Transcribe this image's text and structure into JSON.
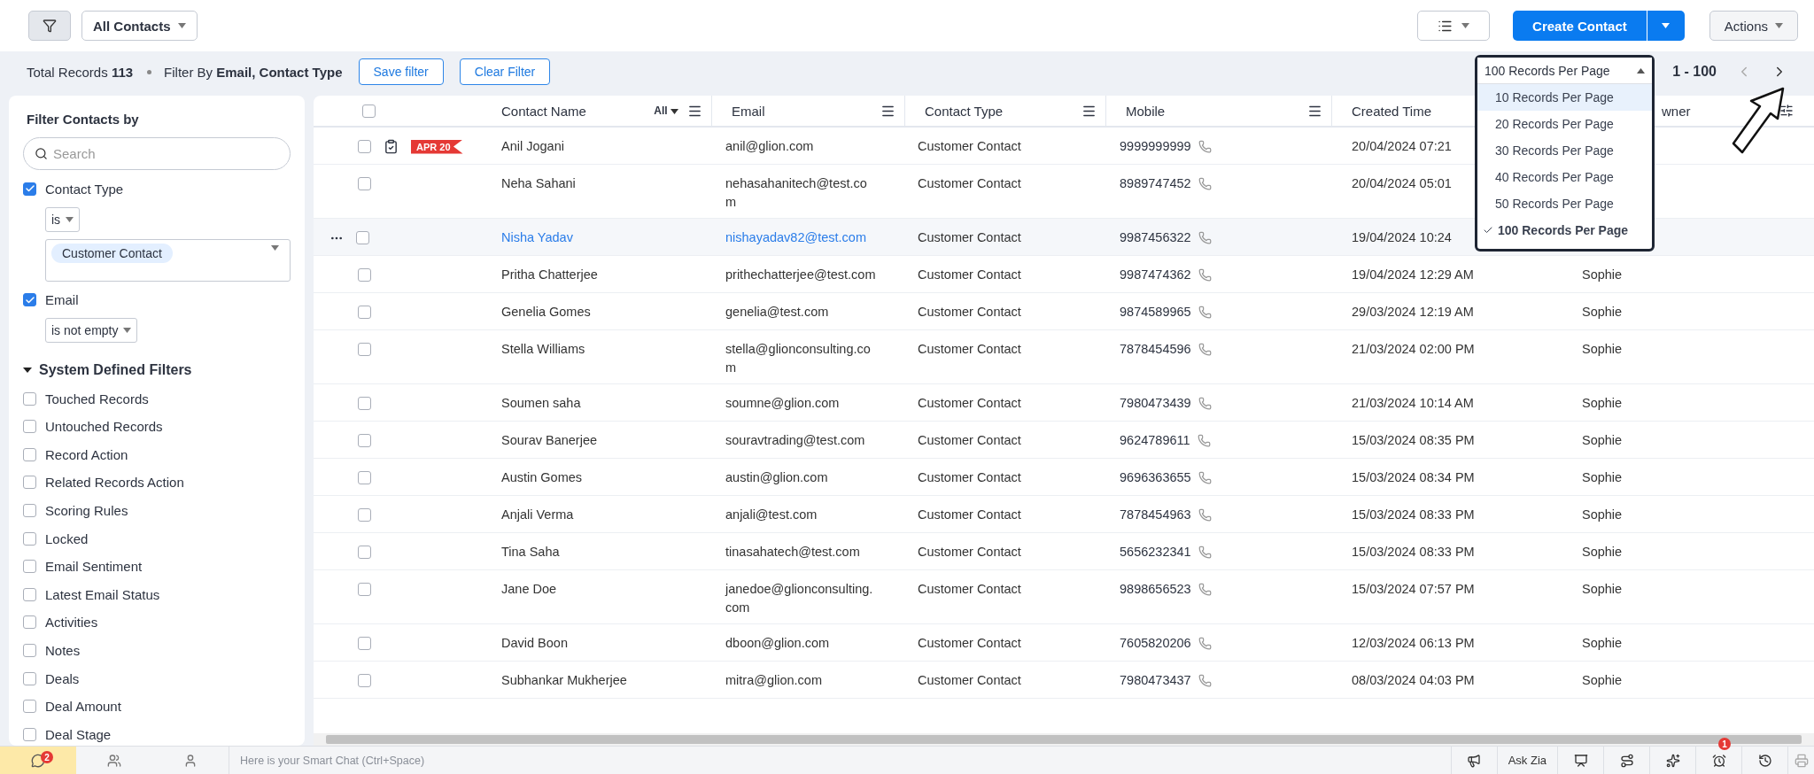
{
  "view_selector": {
    "label": "All Contacts"
  },
  "create_button": {
    "label": "Create Contact"
  },
  "actions_button": {
    "label": "Actions"
  },
  "filter_bar": {
    "summary": "Total Records **113**",
    "filter_by": "Filter By **Email, Contact Type**",
    "buttons": [
      "Save filter",
      "Clear Filter"
    ]
  },
  "pagination": {
    "per_page": {
      "value": "100 Records Per Page",
      "expanded": true,
      "options": [
        {
          "label": "10 Records Per Page",
          "selected": false,
          "highlighted": true
        },
        {
          "label": "20 Records Per Page",
          "selected": false,
          "highlighted": false
        },
        {
          "label": "30 Records Per Page",
          "selected": false,
          "highlighted": false
        },
        {
          "label": "40 Records Per Page",
          "selected": false,
          "highlighted": false
        },
        {
          "label": "50 Records Per Page",
          "selected": false,
          "highlighted": false
        },
        {
          "label": "100 Records Per Page",
          "selected": true,
          "highlighted": false
        }
      ]
    },
    "range": "1 - 100"
  },
  "sidebar": {
    "title": "Filter Contacts by",
    "search_placeholder": "Search",
    "field_filters": [
      {
        "label": "Contact Type",
        "checked": true,
        "operator": "is",
        "values": [
          "Customer Contact"
        ]
      },
      {
        "label": "Email",
        "checked": true,
        "operator": "is not empty"
      }
    ],
    "section": {
      "title": "System Defined Filters",
      "expanded": true,
      "items": [
        {
          "label": "Touched Records",
          "checked": false
        },
        {
          "label": "Untouched Records",
          "checked": false
        },
        {
          "label": "Record Action",
          "checked": false
        },
        {
          "label": "Related Records Action",
          "checked": false
        },
        {
          "label": "Scoring Rules",
          "checked": false
        },
        {
          "label": "Locked",
          "checked": false
        },
        {
          "label": "Email Sentiment",
          "checked": false
        },
        {
          "label": "Latest Email Status",
          "checked": false
        },
        {
          "label": "Activities",
          "checked": false
        },
        {
          "label": "Notes",
          "checked": false
        },
        {
          "label": "Deals",
          "checked": false
        },
        {
          "label": "Deal Amount",
          "checked": false
        },
        {
          "label": "Deal Stage",
          "checked": false
        }
      ]
    }
  },
  "table": {
    "select_all_checked": false,
    "columns": [
      {
        "label": "Contact Name",
        "filter": "All",
        "menu": true
      },
      {
        "label": "Email",
        "menu": true
      },
      {
        "label": "Contact Type",
        "menu": true
      },
      {
        "label": "Mobile",
        "menu": true
      },
      {
        "label": "Created Time",
        "menu": false
      },
      {
        "label": "wner"
      }
    ],
    "rows": [
      {
        "checked": false,
        "highlighted": false,
        "tag": "APR 20",
        "name": "Anil Jogani",
        "email": "anil@glion.com",
        "type": "Customer Contact",
        "mobile": "9999999999",
        "created": "20/04/2024 07:21"
      },
      {
        "checked": false,
        "highlighted": false,
        "name": "Neha Sahani",
        "email": "nehasahanitech@test.com",
        "type": "Customer Contact",
        "mobile": "8989747452",
        "created": "20/04/2024 05:01"
      },
      {
        "checked": false,
        "highlighted": true,
        "name": "Nisha Yadav",
        "email": "nishayadav82@test.com",
        "type": "Customer Contact",
        "mobile": "9987456322",
        "created": "19/04/2024 10:24"
      },
      {
        "checked": false,
        "highlighted": false,
        "name": "Pritha Chatterjee",
        "email": "prithechatterjee@test.com",
        "type": "Customer Contact",
        "mobile": "9987474362",
        "created": "19/04/2024 12:29 AM",
        "owner": "Sophie"
      },
      {
        "checked": false,
        "highlighted": false,
        "name": "Genelia Gomes",
        "email": "genelia@test.com",
        "type": "Customer Contact",
        "mobile": "9874589965",
        "created": "29/03/2024 12:19 AM",
        "owner": "Sophie"
      },
      {
        "checked": false,
        "highlighted": false,
        "name": "Stella Williams",
        "email": "stella@glionconsulting.com",
        "type": "Customer Contact",
        "mobile": "7878454596",
        "created": "21/03/2024 02:00 PM",
        "owner": "Sophie"
      },
      {
        "checked": false,
        "highlighted": false,
        "name": "Soumen saha",
        "email": "soumne@glion.com",
        "type": "Customer Contact",
        "mobile": "7980473439",
        "created": "21/03/2024 10:14 AM",
        "owner": "Sophie"
      },
      {
        "checked": false,
        "highlighted": false,
        "name": "Sourav Banerjee",
        "email": "souravtrading@test.com",
        "type": "Customer Contact",
        "mobile": "9624789611",
        "created": "15/03/2024 08:35 PM",
        "owner": "Sophie"
      },
      {
        "checked": false,
        "highlighted": false,
        "name": "Austin Gomes",
        "email": "austin@glion.com",
        "type": "Customer Contact",
        "mobile": "9696363655",
        "created": "15/03/2024 08:34 PM",
        "owner": "Sophie"
      },
      {
        "checked": false,
        "highlighted": false,
        "name": "Anjali Verma",
        "email": "anjali@test.com",
        "type": "Customer Contact",
        "mobile": "7878454963",
        "created": "15/03/2024 08:33 PM",
        "owner": "Sophie"
      },
      {
        "checked": false,
        "highlighted": false,
        "name": "Tina Saha",
        "email": "tinasahatech@test.com",
        "type": "Customer Contact",
        "mobile": "5656232341",
        "created": "15/03/2024 08:33 PM",
        "owner": "Sophie"
      },
      {
        "checked": false,
        "highlighted": false,
        "name": "Jane Doe",
        "email": "janedoe@glionconsulting.com",
        "type": "Customer Contact",
        "mobile": "9898656523",
        "created": "15/03/2024 07:57 PM",
        "owner": "Sophie"
      },
      {
        "checked": false,
        "highlighted": false,
        "name": "David Boon",
        "email": "dboon@glion.com",
        "type": "Customer Contact",
        "mobile": "7605820206",
        "created": "12/03/2024 06:13 PM",
        "owner": "Sophie"
      },
      {
        "checked": false,
        "highlighted": false,
        "name": "Subhankar Mukherjee",
        "email": "mitra@glion.com",
        "type": "Customer Contact",
        "mobile": "7980473437",
        "created": "08/03/2024 04:03 PM",
        "owner": "Sophie"
      }
    ]
  },
  "bottom_bar": {
    "chat_badge": "2",
    "chat_placeholder": "Here is your Smart Chat (Ctrl+Space)",
    "ask_zia": "Ask Zia",
    "alarm_badge": "1"
  }
}
